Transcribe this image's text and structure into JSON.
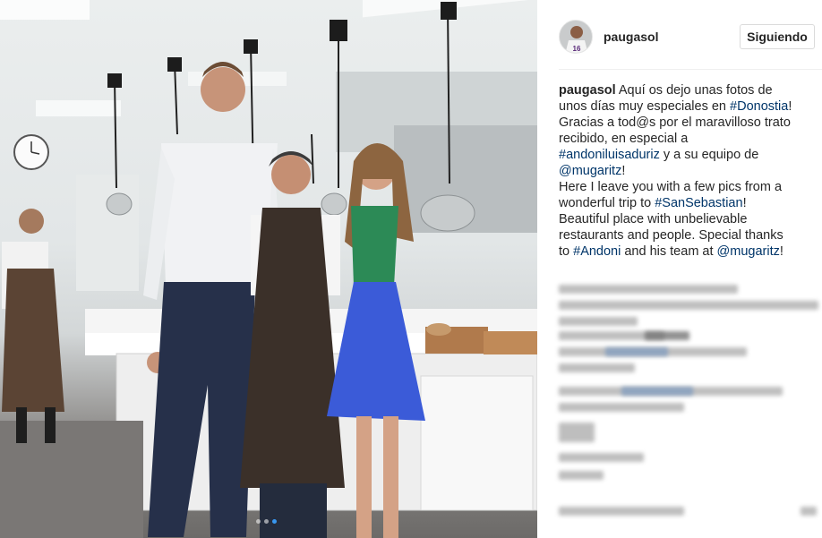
{
  "post": {
    "username": "paugasol",
    "follow_label": "Siguiendo",
    "caption": {
      "author": "paugasol",
      "lines": [
        [
          {
            "t": " Aquí os dejo unas fotos de",
            "k": "text"
          }
        ],
        [
          {
            "t": "unos días muy especiales en ",
            "k": "text"
          },
          {
            "t": "#Donostia",
            "k": "tag"
          },
          {
            "t": "!",
            "k": "text"
          }
        ],
        [
          {
            "t": "Gracias a tod@s por el maravilloso trato",
            "k": "text"
          }
        ],
        [
          {
            "t": "recibido, en especial a",
            "k": "text"
          }
        ],
        [
          {
            "t": "#andoniluisaduriz",
            "k": "tag"
          },
          {
            "t": " y a su equipo de",
            "k": "text"
          }
        ],
        [
          {
            "t": "@mugaritz",
            "k": "tag"
          },
          {
            "t": "!",
            "k": "text"
          }
        ],
        [
          {
            "t": "Here I leave you with a few pics from a",
            "k": "text"
          }
        ],
        [
          {
            "t": "wonderful trip to ",
            "k": "text"
          },
          {
            "t": "#SanSebastian",
            "k": "tag"
          },
          {
            "t": "!",
            "k": "text"
          }
        ],
        [
          {
            "t": "Beautiful place with unbelievable",
            "k": "text"
          }
        ],
        [
          {
            "t": "restaurants and people. Special thanks",
            "k": "text"
          }
        ],
        [
          {
            "t": "to ",
            "k": "text"
          },
          {
            "t": "#Andoni",
            "k": "tag"
          },
          {
            "t": " and his team at ",
            "k": "text"
          },
          {
            "t": "@mugaritz",
            "k": "tag"
          },
          {
            "t": "!",
            "k": "text"
          }
        ]
      ]
    },
    "carousel": {
      "count": 3,
      "active": 2
    },
    "colors": {
      "link": "#003569",
      "text": "#262626",
      "active_dot": "#3897f0",
      "border": "#dbdbdb"
    }
  }
}
